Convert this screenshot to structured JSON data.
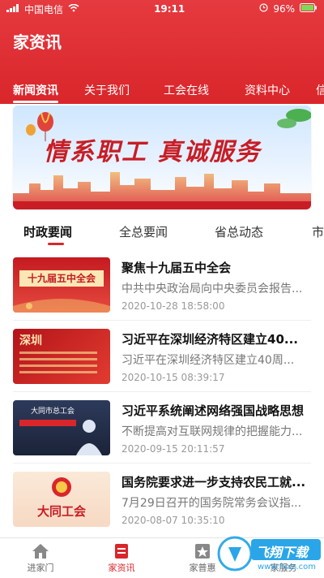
{
  "status": {
    "carrier": "中国电信",
    "time": "19:11",
    "battery": "96%"
  },
  "header": {
    "title": "家资讯"
  },
  "tabs": [
    "新闻资讯",
    "关于我们",
    "工会在线",
    "资料中心",
    "信息"
  ],
  "banner": {
    "slogan": "情系职工 真诚服务"
  },
  "subtabs": [
    "时政要闻",
    "全总要闻",
    "省总动态",
    "市"
  ],
  "news": [
    {
      "title": "聚焦十九届五中全会",
      "summary": "中共中央政治局向中央委员会报告...",
      "date": "2020-10-28 18:58:00",
      "thumb_text": "十九届五中全会"
    },
    {
      "title": "习近平在深圳经济特区建立40...",
      "summary": "习近平在深圳经济特区建立40周...",
      "date": "2020-10-15 08:39:17",
      "thumb_text": "深圳"
    },
    {
      "title": "习近平系统阐述网络强国战略思想",
      "summary": "不断提高对互联网规律的把握能力...",
      "date": "2020-09-15 20:11:57",
      "thumb_text": "大同市总工会"
    },
    {
      "title": "国务院要求进一步支持农民工就...",
      "summary": "7月29日召开的国务院常务会议指...",
      "date": "2020-08-07 10:35:10",
      "thumb_text": "大同工会"
    }
  ],
  "bottomnav": [
    "进家门",
    "家资讯",
    "家普惠",
    "家服务"
  ],
  "watermark": {
    "text": "飞翔下载",
    "url": "www.fxxz.com"
  },
  "colors": {
    "brand_red": "#d9262b"
  }
}
